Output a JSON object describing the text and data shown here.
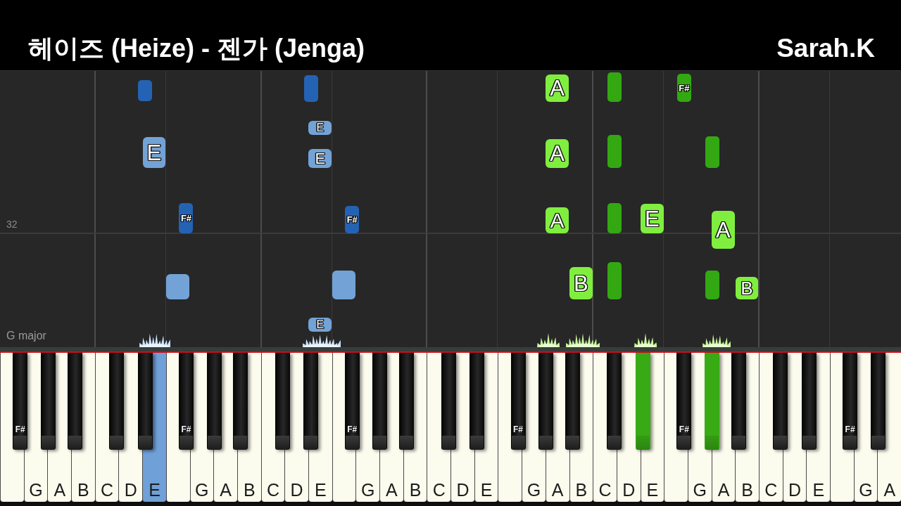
{
  "header": {
    "title": "헤이즈 (Heize) - 젠가 (Jenga)",
    "channel": "Sarah.K"
  },
  "roll": {
    "measure": "32",
    "key_signature": "G major",
    "notes": [
      {
        "color": "#2463b3"
      },
      {
        "label": "E",
        "color": "#73a3d6"
      },
      {
        "label": "F#",
        "color": "#2463b3"
      },
      {
        "color": "#73a3d6"
      },
      {
        "color": "#2463b3"
      },
      {
        "label": "E",
        "color": "#73a3d6"
      },
      {
        "label": "E",
        "color": "#73a3d6"
      },
      {
        "label": "F#",
        "color": "#2463b3"
      },
      {
        "color": "#73a3d6"
      },
      {
        "label": "E",
        "color": "#73a3d6"
      },
      {
        "label": "A",
        "color": "#80ee3e"
      },
      {
        "color": "#33a812"
      },
      {
        "label": "F#",
        "color": "#33a812"
      },
      {
        "label": "A",
        "color": "#80ee3e"
      },
      {
        "color": "#33a812"
      },
      {
        "color": "#33a812"
      },
      {
        "label": "A",
        "color": "#80ee3e"
      },
      {
        "color": "#33a812"
      },
      {
        "label": "E",
        "color": "#80ee3e"
      },
      {
        "label": "A",
        "color": "#80ee3e"
      },
      {
        "label": "B",
        "color": "#80ee3e"
      },
      {
        "color": "#33a812"
      },
      {
        "color": "#33a812"
      },
      {
        "label": "B",
        "color": "#80ee3e"
      }
    ]
  },
  "keyboard": {
    "keys": [
      {
        "kind": "white",
        "pressed": false
      },
      {
        "kind": "black",
        "label": "F#",
        "pressed": false
      },
      {
        "kind": "white",
        "label": "G",
        "pressed": false
      },
      {
        "kind": "black",
        "pressed": false
      },
      {
        "kind": "white",
        "label": "A",
        "pressed": false
      },
      {
        "kind": "black",
        "pressed": false
      },
      {
        "kind": "white",
        "label": "B",
        "pressed": false
      },
      {
        "kind": "white",
        "label": "C",
        "pressed": false
      },
      {
        "kind": "black",
        "pressed": false
      },
      {
        "kind": "white",
        "label": "D",
        "pressed": false
      },
      {
        "kind": "black",
        "pressed": false
      },
      {
        "kind": "white",
        "label": "E",
        "pressed": true,
        "color": "#6fa0d8"
      },
      {
        "kind": "white",
        "pressed": false
      },
      {
        "kind": "black",
        "label": "F#",
        "pressed": false
      },
      {
        "kind": "white",
        "label": "G",
        "pressed": false
      },
      {
        "kind": "black",
        "pressed": false
      },
      {
        "kind": "white",
        "label": "A",
        "pressed": false
      },
      {
        "kind": "black",
        "pressed": false
      },
      {
        "kind": "white",
        "label": "B",
        "pressed": false
      },
      {
        "kind": "white",
        "label": "C",
        "pressed": false
      },
      {
        "kind": "black",
        "pressed": false
      },
      {
        "kind": "white",
        "label": "D",
        "pressed": false
      },
      {
        "kind": "black",
        "pressed": false
      },
      {
        "kind": "white",
        "label": "E",
        "pressed": false
      },
      {
        "kind": "white",
        "pressed": false
      },
      {
        "kind": "black",
        "label": "F#",
        "pressed": false
      },
      {
        "kind": "white",
        "label": "G",
        "pressed": false
      },
      {
        "kind": "black",
        "pressed": false
      },
      {
        "kind": "white",
        "label": "A",
        "pressed": false
      },
      {
        "kind": "black",
        "pressed": false
      },
      {
        "kind": "white",
        "label": "B",
        "pressed": false
      },
      {
        "kind": "white",
        "label": "C",
        "pressed": false
      },
      {
        "kind": "black",
        "pressed": false
      },
      {
        "kind": "white",
        "label": "D",
        "pressed": false
      },
      {
        "kind": "black",
        "pressed": false
      },
      {
        "kind": "white",
        "label": "E",
        "pressed": false
      },
      {
        "kind": "white",
        "pressed": false
      },
      {
        "kind": "black",
        "label": "F#",
        "pressed": false
      },
      {
        "kind": "white",
        "label": "G",
        "pressed": false
      },
      {
        "kind": "black",
        "pressed": false
      },
      {
        "kind": "white",
        "label": "A",
        "pressed": false
      },
      {
        "kind": "black",
        "pressed": false
      },
      {
        "kind": "white",
        "label": "B",
        "pressed": false
      },
      {
        "kind": "white",
        "label": "C",
        "pressed": false
      },
      {
        "kind": "black",
        "pressed": false
      },
      {
        "kind": "white",
        "label": "D",
        "pressed": false
      },
      {
        "kind": "black",
        "pressed": true,
        "color": "#38aa14"
      },
      {
        "kind": "white",
        "label": "E",
        "pressed": false
      },
      {
        "kind": "white",
        "pressed": false
      },
      {
        "kind": "black",
        "label": "F#",
        "pressed": false
      },
      {
        "kind": "white",
        "label": "G",
        "pressed": false
      },
      {
        "kind": "black",
        "pressed": true,
        "color": "#38aa14"
      },
      {
        "kind": "white",
        "label": "A",
        "pressed": false
      },
      {
        "kind": "black",
        "pressed": false
      },
      {
        "kind": "white",
        "label": "B",
        "pressed": false
      },
      {
        "kind": "white",
        "label": "C",
        "pressed": false
      },
      {
        "kind": "black",
        "pressed": false
      },
      {
        "kind": "white",
        "label": "D",
        "pressed": false
      },
      {
        "kind": "black",
        "pressed": false
      },
      {
        "kind": "white",
        "label": "E",
        "pressed": false
      },
      {
        "kind": "white",
        "pressed": false
      },
      {
        "kind": "black",
        "label": "F#",
        "pressed": false
      },
      {
        "kind": "white",
        "label": "G",
        "pressed": false
      },
      {
        "kind": "black",
        "pressed": false
      },
      {
        "kind": "white",
        "label": "A",
        "pressed": false
      }
    ]
  }
}
